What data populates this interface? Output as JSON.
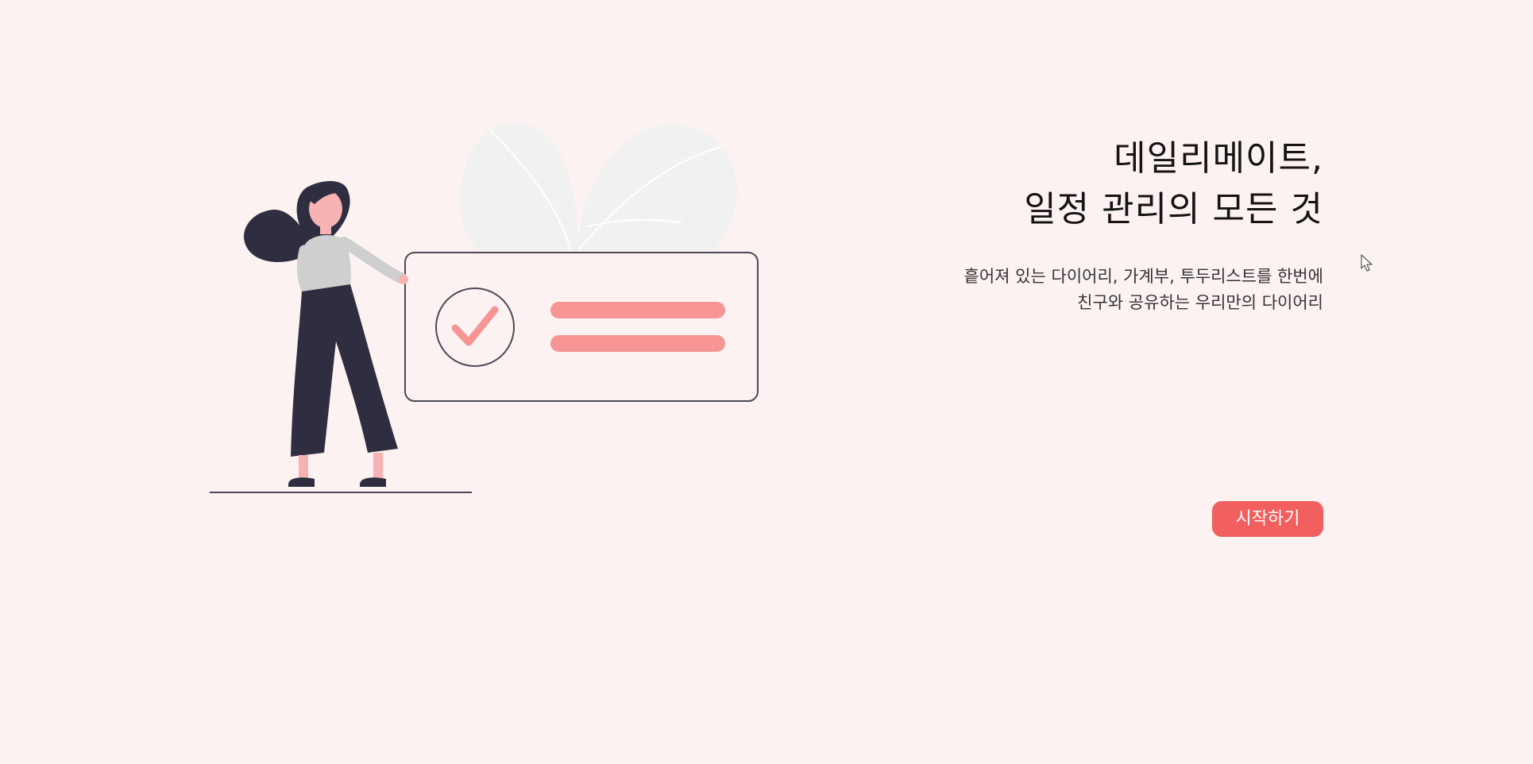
{
  "hero": {
    "headline_line1": "데일리메이트,",
    "headline_line2": "일정 관리의 모든 것",
    "subline_line1": "흩어져 있는 다이어리, 가계부, 투두리스트를 한번에",
    "subline_line2": "친구와 공유하는 우리만의 다이어리"
  },
  "cta": {
    "start_label": "시작하기"
  },
  "colors": {
    "background": "#fcf2f1",
    "accent": "#f25f5f",
    "illustration_pink": "#f79595",
    "illustration_dark": "#2f2e41"
  },
  "icons": {
    "illustration": "woman-with-checklist-illustration",
    "check": "check-icon",
    "cursor": "mouse-cursor-icon"
  }
}
